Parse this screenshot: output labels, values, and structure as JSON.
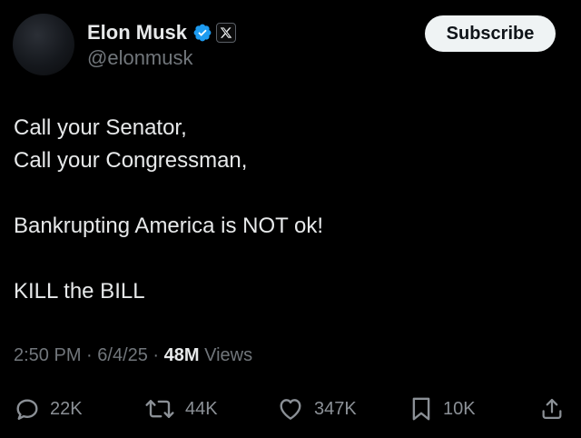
{
  "author": {
    "display_name": "Elon Musk",
    "handle": "@elonmusk",
    "verified_icon": "verified-badge",
    "affiliation_icon": "x-logo"
  },
  "subscribe_label": "Subscribe",
  "tweet": {
    "lines": [
      "Call your Senator,",
      "Call your Congressman,",
      "",
      "Bankrupting America is NOT ok!",
      "",
      "KILL the BILL"
    ]
  },
  "meta": {
    "time": "2:50 PM",
    "date": "6/4/25",
    "separator": " · ",
    "views_count": "48M",
    "views_label": " Views"
  },
  "actions": {
    "replies": "22K",
    "reposts": "44K",
    "likes": "347K",
    "bookmarks": "10K"
  },
  "colors": {
    "background": "#000000",
    "text": "#e7e9ea",
    "secondary_text": "#71767b",
    "verified_blue": "#1d9bf0",
    "button_bg": "#eff3f4"
  }
}
